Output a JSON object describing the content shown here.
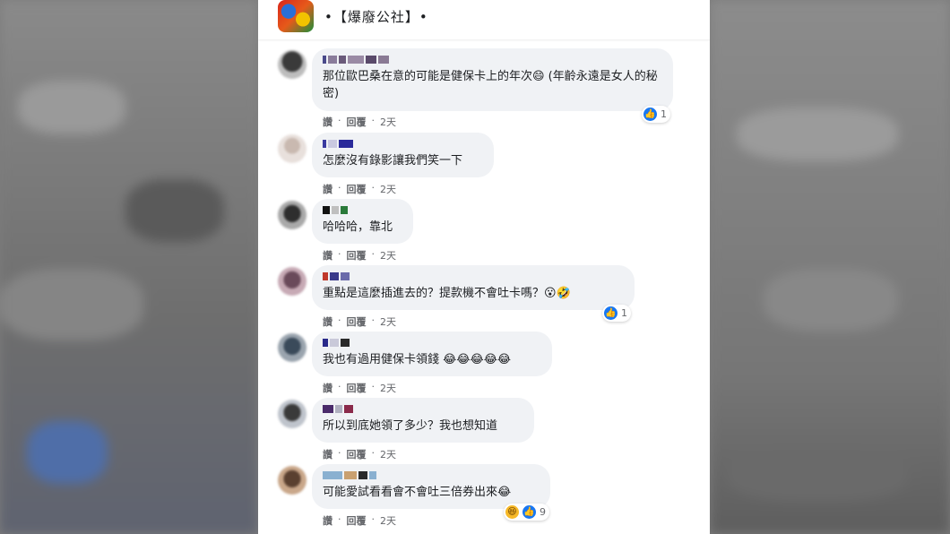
{
  "header": {
    "page_name": "•【爆廢公社】•"
  },
  "icons": {
    "logo": "page-logo-icon",
    "like": "like-icon",
    "haha": "haha-icon",
    "wow": "wow-icon"
  },
  "colors": {
    "bubble": "#f0f2f5",
    "like": "#1877f2",
    "haha": "#f7b928"
  },
  "comments": [
    {
      "text": "那位歐巴桑在意的可能是健保卡上的年次😄 (年齡永遠是女人的秘密)",
      "like": "讚",
      "reply": "回覆",
      "time": "2天",
      "reactions": "1"
    },
    {
      "text": "怎麼沒有錄影讓我們笑一下",
      "like": "讚",
      "reply": "回覆",
      "time": "2天"
    },
    {
      "text": "哈哈哈，靠北",
      "like": "讚",
      "reply": "回覆",
      "time": "2天"
    },
    {
      "text": "重點是這麼插進去的？提款機不會吐卡嗎？😮🤣",
      "like": "讚",
      "reply": "回覆",
      "time": "2天",
      "reactions": "1"
    },
    {
      "text": "我也有過用健保卡領錢 😂😂😂😂😂",
      "like": "讚",
      "reply": "回覆",
      "time": "2天"
    },
    {
      "text": "所以到底她領了多少？我也想知道",
      "like": "讚",
      "reply": "回覆",
      "time": "2天"
    },
    {
      "text": "可能愛試看看會不會吐三倍券出來😂",
      "like": "讚",
      "reply": "回覆",
      "time": "2天",
      "reactions": "9"
    }
  ]
}
